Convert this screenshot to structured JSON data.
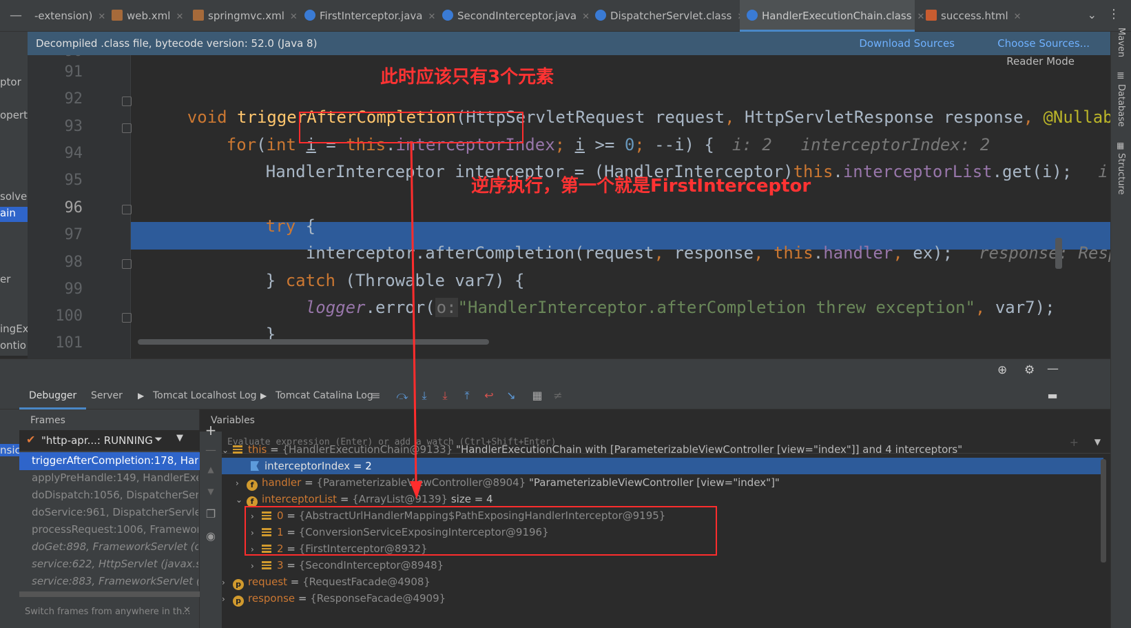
{
  "tabs": [
    {
      "label": "-extension)",
      "icon": "none"
    },
    {
      "label": "web.xml",
      "icon": "xml-file-icon"
    },
    {
      "label": "springmvc.xml",
      "icon": "xml-file-icon"
    },
    {
      "label": "FirstInterceptor.java",
      "icon": "java-class-icon"
    },
    {
      "label": "SecondInterceptor.java",
      "icon": "java-class-icon"
    },
    {
      "label": "DispatcherServlet.class",
      "icon": "java-class-icon"
    },
    {
      "label": "HandlerExecutionChain.class",
      "icon": "java-class-icon"
    },
    {
      "label": "success.html",
      "icon": "html-file-icon"
    }
  ],
  "banner": {
    "text": "Decompiled .class file, bytecode version: 52.0 (Java 8)",
    "download_sources": "Download Sources",
    "choose_sources": "Choose Sources..."
  },
  "reader_mode": "Reader Mode",
  "left_strip": [
    "ptor",
    "opert",
    "solver",
    "ain",
    "er",
    "ingEx",
    "ontio"
  ],
  "right_strip": [
    "Maven",
    "Database",
    "Structure"
  ],
  "editor": {
    "line_numbers": [
      "90",
      "91",
      "92",
      "93",
      "94",
      "95",
      "96",
      "97",
      "98",
      "99",
      "100",
      "101"
    ],
    "current_line": "96",
    "lines": {
      "l92": {
        "kw": "void ",
        "fn": "triggerAfterCompletion",
        "p1": "(HttpServletRequest request",
        "c1": ", ",
        "p2": "HttpServletResponse response",
        "c2": ", ",
        "ann": "@Nullab"
      },
      "l93": {
        "kw_for": "for",
        "p1": "(",
        "kw_int": "int ",
        "var": "i",
        "eq": " = ",
        "this": "this",
        "dot": ".",
        "fld": "interceptorIndex",
        "semi": ";",
        "sp": " ",
        "var2": "i",
        "cmp": " >= ",
        "num": "0",
        "semi2": "; ",
        "dec": "--i",
        "end": ") {",
        "hint1": "i: 2",
        "hint2": "interceptorIndex: 2"
      },
      "l94": {
        "p1": "HandlerInterceptor interceptor = (HandlerInterceptor)",
        "this": "this",
        "dot": ".",
        "fld": "interceptorList",
        "p2": ".get(i);",
        "hint": "i"
      },
      "l96": {
        "kw": "try",
        "p": " {"
      },
      "l97": {
        "p1": "interceptor.afterCompletion(request",
        "c1": ", ",
        "p2": "response",
        "c2": ", ",
        "this": "this",
        "dot": ".",
        "fld": "handler",
        "c3": ", ",
        "p3": "ex);",
        "hint": "response: Resp"
      },
      "l98": {
        "p1": "} ",
        "kw": "catch",
        "p2": " (Throwable var7) {"
      },
      "l99": {
        "logger": "logger",
        "p1": ".error(",
        "hint": "o:",
        "str": "\"HandlerInterceptor.afterCompletion threw exception\"",
        "c": ", ",
        "p2": "var7);"
      },
      "l100": {
        "p": "}"
      }
    }
  },
  "annotations": {
    "top_note": "此时应该只有3个元素",
    "mid_note": "逆序执行，第一个就是FirstInterceptor"
  },
  "debug": {
    "tabs": [
      "Debugger",
      "Server",
      "Tomcat Localhost Log",
      "Tomcat Catalina Log"
    ],
    "frames_title": "Frames",
    "variables_title": "Variables",
    "thread": "\"http-apr...: RUNNING",
    "frames": [
      "triggerAfterCompletion:178, HandlerE",
      "applyPreHandle:149, HandlerExecu",
      "doDispatch:1056, DispatcherServl",
      "doService:961, DispatcherServlet",
      "processRequest:1006, FrameworkS",
      "doGet:898, FrameworkServlet (or",
      "service:622, HttpServlet (javax.se",
      "service:883, FrameworkServlet (o"
    ],
    "left_cut": [
      "nsic"
    ],
    "frames_search": "Switch frames from anywhere in th...",
    "eval_placeholder": "Evaluate expression (Enter) or add a watch (Ctrl+Shift+Enter)",
    "vars": {
      "this_name": "this",
      "this_ref": "{HandlerExecutionChain@9133}",
      "this_str": "\"HandlerExecutionChain with [ParameterizableViewController [view=\"index\"]] and 4 interceptors\"",
      "idx_name": "interceptorIndex",
      "idx_val": "2",
      "handler_name": "handler",
      "handler_ref": "{ParameterizableViewController@8904}",
      "handler_str": "\"ParameterizableViewController [view=\"index\"]\"",
      "list_name": "interceptorList",
      "list_ref": "{ArrayList@9139}",
      "list_size": "size = 4",
      "items": [
        {
          "idx": "0",
          "ref": "{AbstractUrlHandlerMapping$PathExposingHandlerInterceptor@9195}"
        },
        {
          "idx": "1",
          "ref": "{ConversionServiceExposingInterceptor@9196}"
        },
        {
          "idx": "2",
          "ref": "{FirstInterceptor@8932}"
        },
        {
          "idx": "3",
          "ref": "{SecondInterceptor@8948}"
        }
      ],
      "request_name": "request",
      "request_ref": "{RequestFacade@4908}",
      "response_name": "response",
      "response_ref": "{ResponseFacade@4909}"
    }
  },
  "colors": {
    "accent": "#4a88c7",
    "selection": "#2d5b9a",
    "annotation": "#ff2d2d"
  }
}
